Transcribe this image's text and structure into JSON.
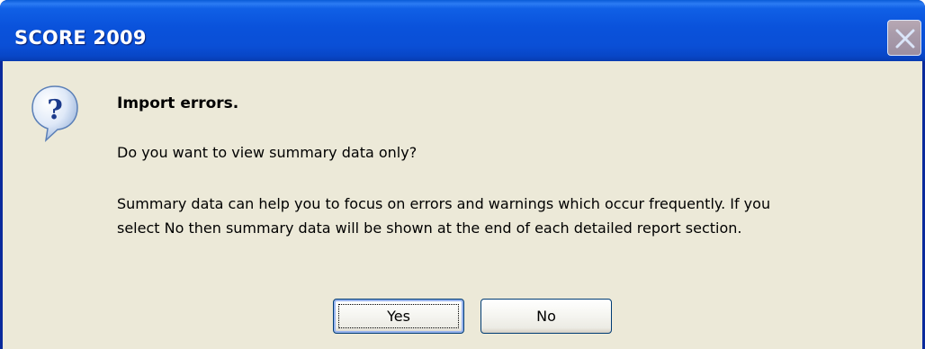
{
  "window": {
    "title": "SCORE 2009"
  },
  "titlebar_buttons": {
    "close_icon": "close-icon"
  },
  "dialog": {
    "icon": "question-icon",
    "heading": "Import errors.",
    "question": "Do you want to view summary data only?",
    "detail_line1": "Summary data can help you to focus on errors and warnings which occur frequently. If you",
    "detail_line2": "select No then summary data will be shown at the end of each detailed report section."
  },
  "buttons": {
    "yes_label": "Yes",
    "no_label": "No"
  },
  "colors": {
    "titlebar": "#0a52db",
    "client_bg": "#ece9d8",
    "button_border": "#003c74"
  }
}
